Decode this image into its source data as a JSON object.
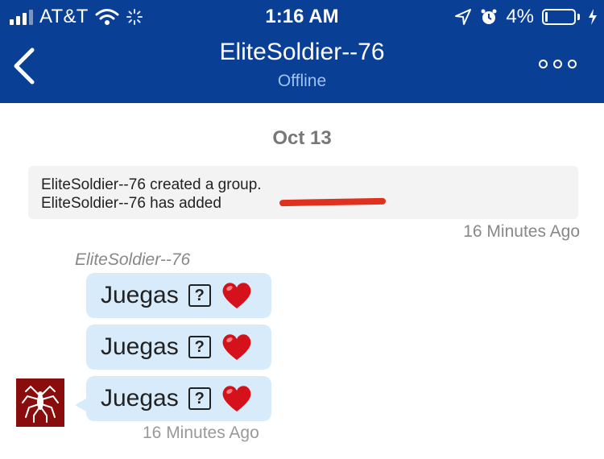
{
  "status_bar": {
    "carrier": "AT&T",
    "time": "1:16 AM",
    "battery": "4%"
  },
  "header": {
    "title": "EliteSoldier--76",
    "subtitle": "Offline",
    "icons": [
      "chevron-left-icon",
      "more-options-icon"
    ]
  },
  "conversation": {
    "date_separator": "Oct 13",
    "system_messages": [
      "EliteSoldier--76 created a group.",
      "EliteSoldier--76 has added"
    ],
    "system_time": "16 Minutes Ago",
    "sender": "EliteSoldier--76",
    "messages": [
      {
        "text": "Juegas",
        "emoji": [
          "question-box",
          "red-heart"
        ]
      },
      {
        "text": "Juegas",
        "emoji": [
          "question-box",
          "red-heart"
        ]
      },
      {
        "text": "Juegas",
        "emoji": [
          "question-box",
          "red-heart"
        ]
      }
    ],
    "message_time": "16 Minutes Ago",
    "question_glyph": "?"
  },
  "colors": {
    "header_bg": "#0a3f96",
    "bubble_bg": "#d7ebfb",
    "redaction": "#e0301e"
  }
}
